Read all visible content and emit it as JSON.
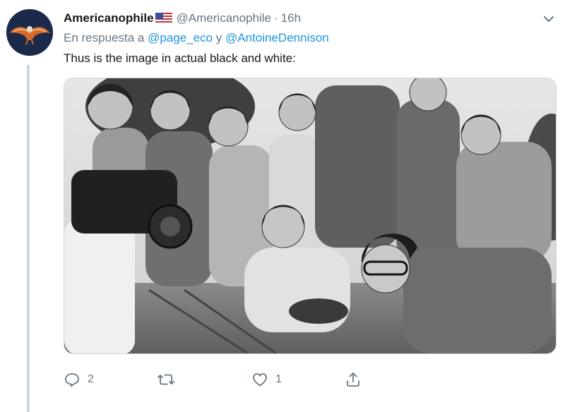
{
  "author": {
    "display_name": "Americanophile",
    "flag_icon": "us-flag-icon",
    "handle": "@Americanophile",
    "separator": "·",
    "time": "16h"
  },
  "reply": {
    "prefix": "En respuesta a",
    "mention_1": "@page_eco",
    "joiner": "y",
    "mention_2": "@AntoineDennison"
  },
  "text": "Thus is the image in actual black and white:",
  "media": {
    "kind": "grayscale photograph",
    "description_icon": "photo-image"
  },
  "actions": {
    "reply_count": "2",
    "retweet_count": "",
    "like_count": "1"
  },
  "colors": {
    "link": "#1b95e0",
    "secondary_text": "#657786",
    "primary_text": "#14171a",
    "thread_line": "#ccd6dd"
  }
}
